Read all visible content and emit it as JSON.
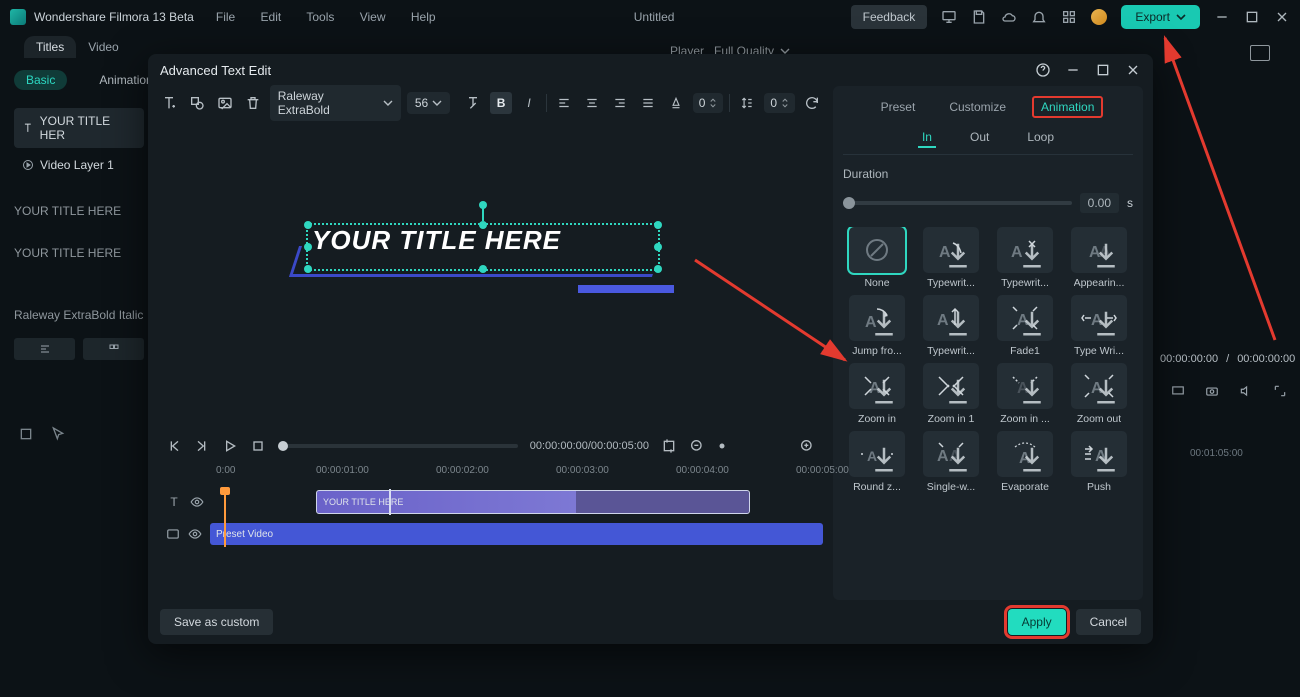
{
  "app": {
    "name": "Wondershare Filmora 13 Beta",
    "doc": "Untitled"
  },
  "menu": {
    "file": "File",
    "edit": "Edit",
    "tools": "Tools",
    "view": "View",
    "help": "Help"
  },
  "feedback": "Feedback",
  "export": "Export",
  "tabs": {
    "titles": "Titles",
    "video": "Video"
  },
  "side": {
    "basic": "Basic",
    "animation": "Animation",
    "layer_title": "YOUR TITLE HER",
    "layer_video": "Video Layer 1",
    "plain1": "YOUR TITLE HERE",
    "plain2": "YOUR TITLE HERE",
    "font": "Raleway ExtraBold Italic"
  },
  "player": {
    "label": "Player",
    "quality": "Full Quality"
  },
  "timecodes": {
    "a": "00:00:00:00",
    "sep": "/",
    "b": "00:00:00:00"
  },
  "main_ruler": "00:01:05:00",
  "dialog": {
    "title": "Advanced Text Edit",
    "font": "Raleway ExtraBold",
    "size": "56",
    "spacing": "0",
    "lineheight": "0",
    "canvas_text": "YOUR TITLE HERE",
    "time": "00:00:00:00/00:00:05:00",
    "ruler": [
      "0:00",
      "00:00:01:00",
      "00:00:02:00",
      "00:00:03:00",
      "00:00:04:00",
      "00:00:05:00"
    ],
    "clip_title": "YOUR TITLE HERE",
    "clip_video": "Preset Video",
    "save": "Save as custom",
    "apply": "Apply",
    "cancel": "Cancel"
  },
  "panel": {
    "preset": "Preset",
    "customize": "Customize",
    "animation": "Animation",
    "in": "In",
    "out": "Out",
    "loop": "Loop",
    "duration": "Duration",
    "durval": "0.00",
    "durunit": "s",
    "items": [
      "None",
      "Typewrit...",
      "Typewrit...",
      "Appearin...",
      "Jump fro...",
      "Typewrit...",
      "Fade1",
      "Type Wri...",
      "Zoom in",
      "Zoom in 1",
      "Zoom in ...",
      "Zoom out",
      "Round z...",
      "Single-w...",
      "Evaporate",
      "Push"
    ]
  }
}
